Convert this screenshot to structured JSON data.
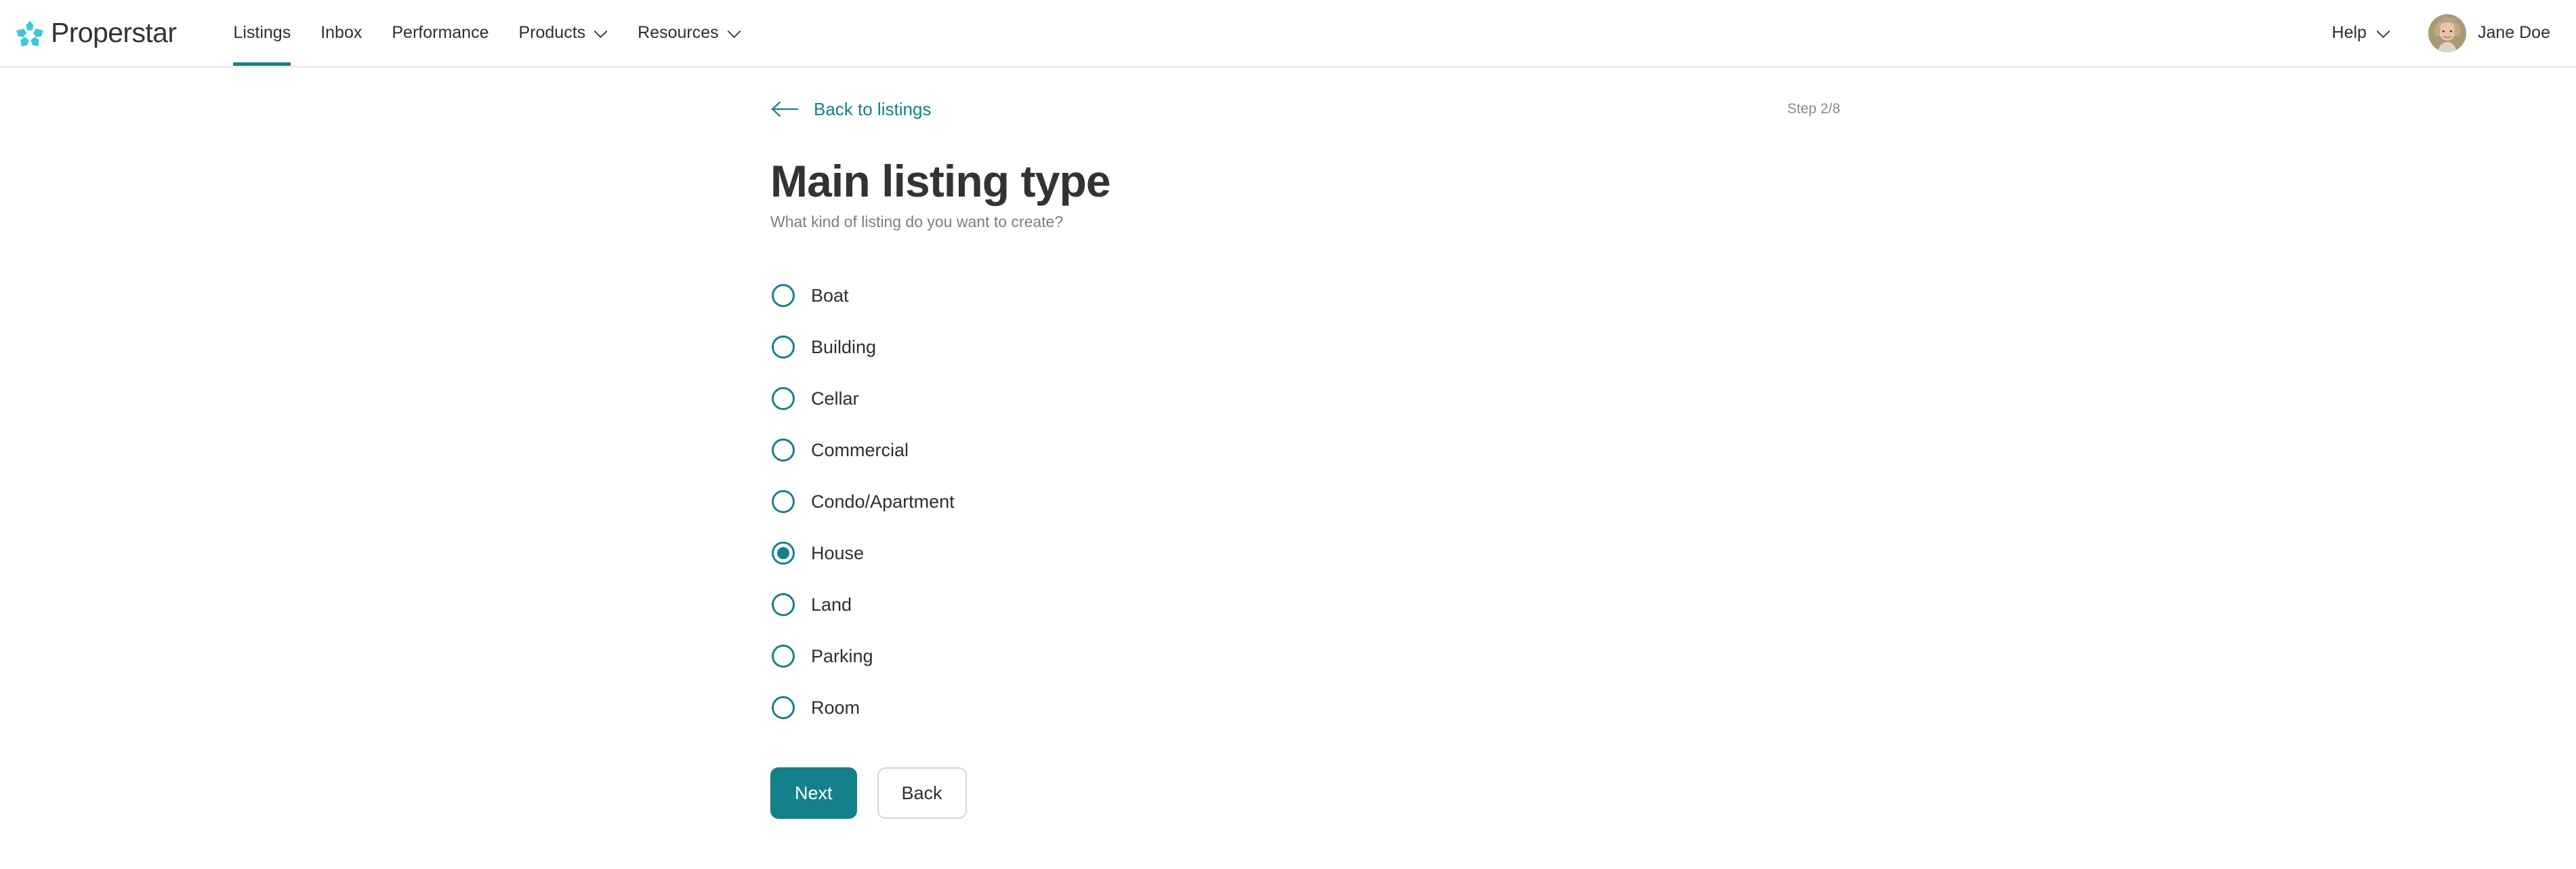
{
  "brand": {
    "name": "Properstar",
    "logo_icon": "properstar-flower-logo",
    "accent_color": "#14808a",
    "logo_mark_color": "#3cc8dc"
  },
  "nav": {
    "items": [
      {
        "label": "Listings",
        "active": true,
        "has_dropdown": false
      },
      {
        "label": "Inbox",
        "active": false,
        "has_dropdown": false
      },
      {
        "label": "Performance",
        "active": false,
        "has_dropdown": false
      },
      {
        "label": "Products",
        "active": false,
        "has_dropdown": true
      },
      {
        "label": "Resources",
        "active": false,
        "has_dropdown": true
      }
    ],
    "help": {
      "label": "Help",
      "has_dropdown": true
    },
    "user": {
      "name": "Jane Doe",
      "avatar_icon": "user-avatar-photo"
    }
  },
  "wizard": {
    "back_link": {
      "label": "Back to listings",
      "icon": "arrow-left-icon"
    },
    "step_indicator": "Step 2/8",
    "title": "Main listing type",
    "subtitle": "What kind of listing do you want to create?",
    "options": [
      {
        "label": "Boat",
        "selected": false
      },
      {
        "label": "Building",
        "selected": false
      },
      {
        "label": "Cellar",
        "selected": false
      },
      {
        "label": "Commercial",
        "selected": false
      },
      {
        "label": "Condo/Apartment",
        "selected": false
      },
      {
        "label": "House",
        "selected": true
      },
      {
        "label": "Land",
        "selected": false
      },
      {
        "label": "Parking",
        "selected": false
      },
      {
        "label": "Room",
        "selected": false
      }
    ],
    "selected_value": "House",
    "buttons": {
      "next": "Next",
      "back": "Back"
    }
  }
}
